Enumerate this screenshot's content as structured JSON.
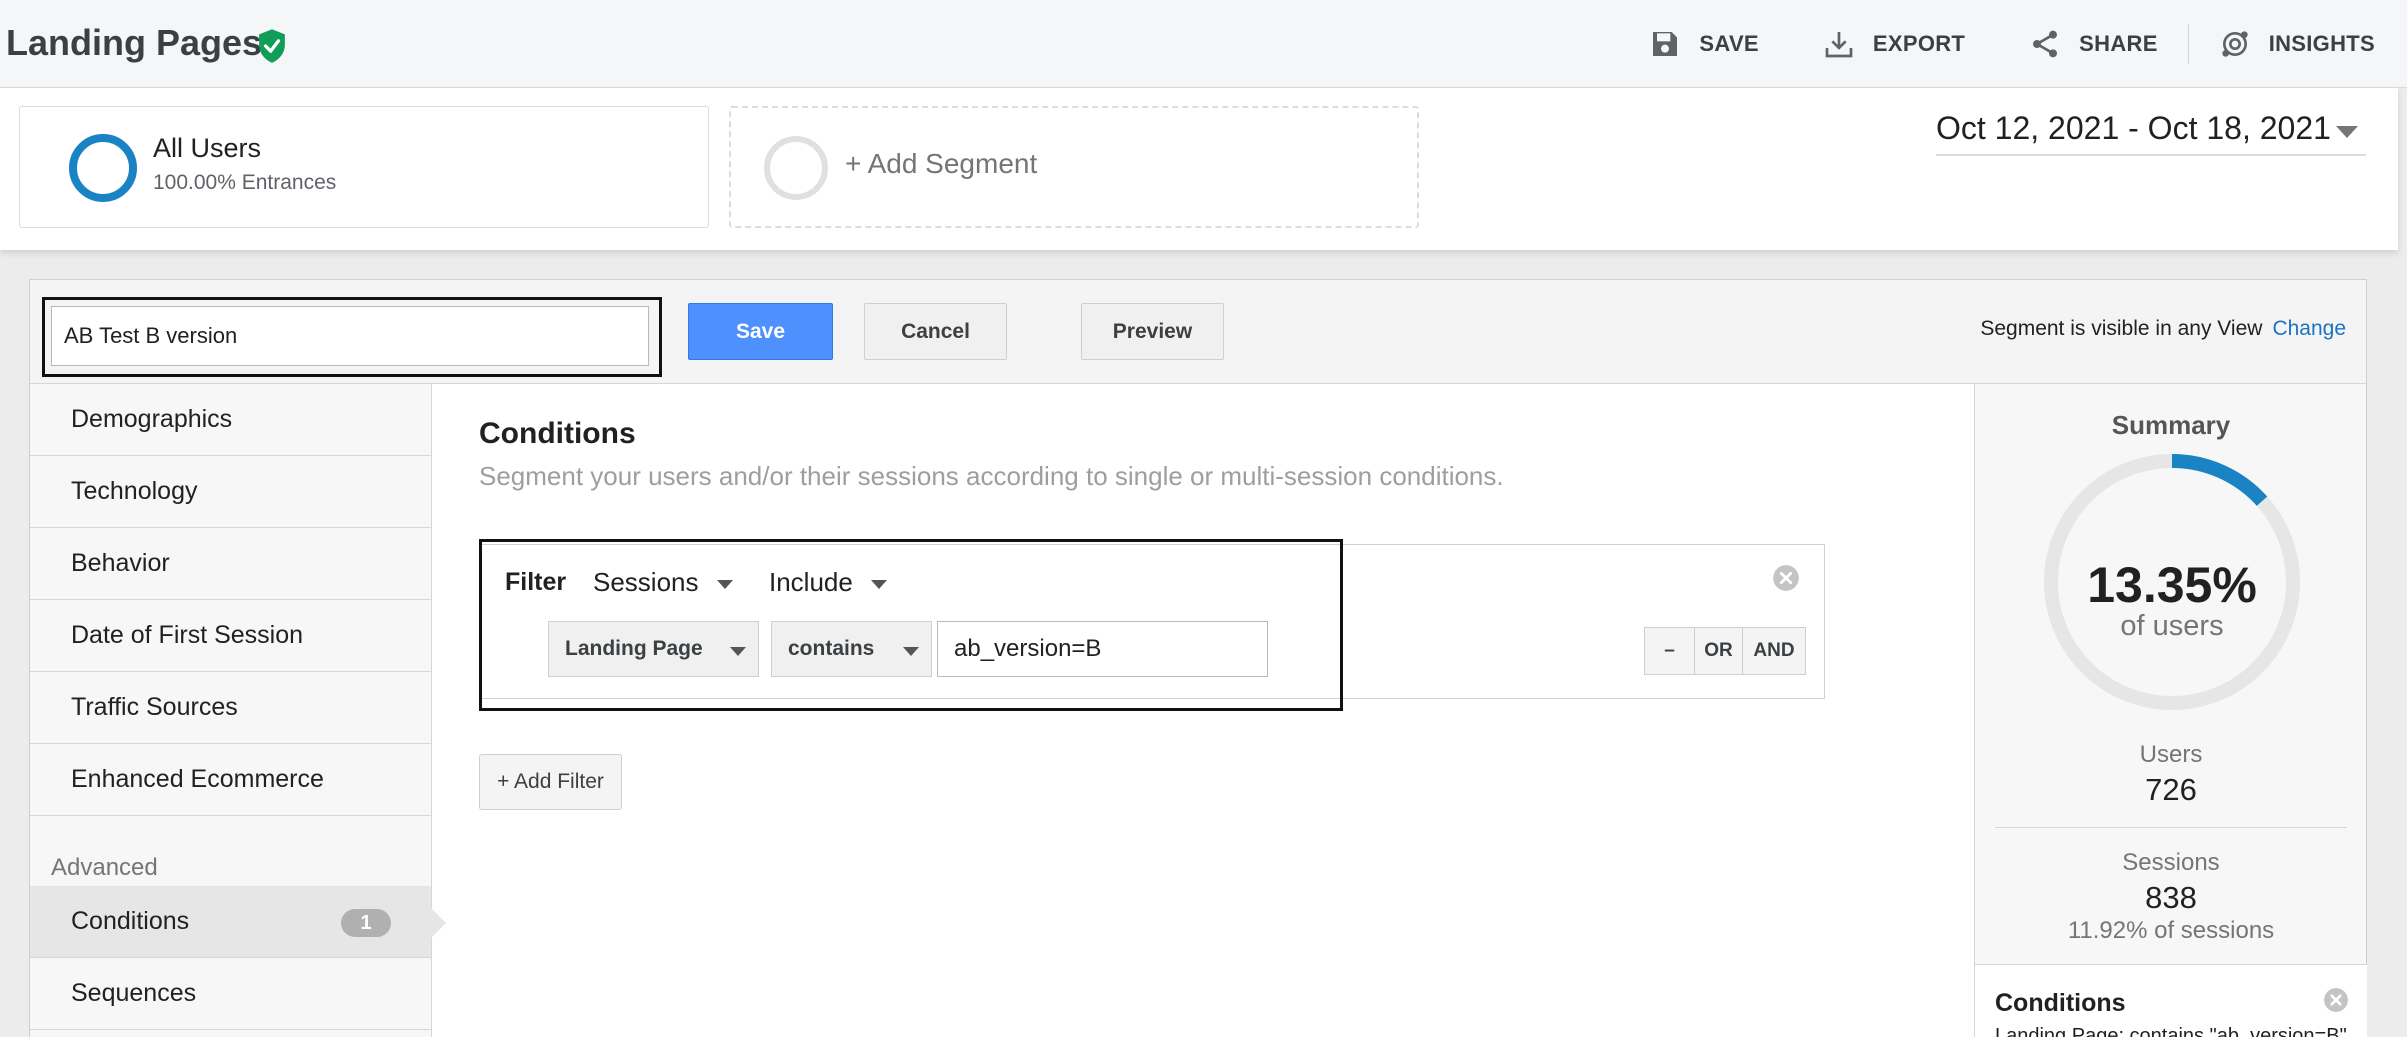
{
  "header": {
    "title": "Landing Pages",
    "actions": [
      {
        "label": "SAVE",
        "icon": "floppy-icon"
      },
      {
        "label": "EXPORT",
        "icon": "download-icon"
      },
      {
        "label": "SHARE",
        "icon": "share-icon"
      },
      {
        "label": "INSIGHTS",
        "icon": "insights-icon"
      }
    ],
    "verified_color": "#0f9d58"
  },
  "segments": {
    "active": {
      "name": "All Users",
      "subtitle": "100.00% Entrances",
      "color": "#1a83c4"
    },
    "add_label": "+ Add Segment"
  },
  "date_range": "Oct 12, 2021 - Oct 18, 2021",
  "builder": {
    "segment_name": "AB Test B version",
    "save_label": "Save",
    "cancel_label": "Cancel",
    "preview_label": "Preview",
    "visibility_text": "Segment is visible in any View",
    "change_label": "Change"
  },
  "sidebar": {
    "items": [
      "Demographics",
      "Technology",
      "Behavior",
      "Date of First Session",
      "Traffic Sources",
      "Enhanced Ecommerce"
    ],
    "advanced_heading": "Advanced",
    "advanced_items": [
      {
        "label": "Conditions",
        "badge": "1"
      },
      {
        "label": "Sequences"
      }
    ]
  },
  "conditions": {
    "title": "Conditions",
    "description": "Segment your users and/or their sessions according to single or multi-session conditions.",
    "filter": {
      "label": "Filter",
      "scope": "Sessions",
      "mode": "Include",
      "dimension": "Landing Page",
      "operator": "contains",
      "value": "ab_version=B",
      "logic": [
        "–",
        "OR",
        "AND"
      ]
    },
    "add_filter_label": "+ Add Filter"
  },
  "summary": {
    "title": "Summary",
    "percent": "13.35%",
    "percent_label": "of users",
    "fraction": 0.1335,
    "users_label": "Users",
    "users_value": "726",
    "sessions_label": "Sessions",
    "sessions_value": "838",
    "sessions_sub": "11.92% of sessions",
    "conditions_title": "Conditions",
    "conditions_text": "Landing Page: contains \"ab_version=B\""
  }
}
